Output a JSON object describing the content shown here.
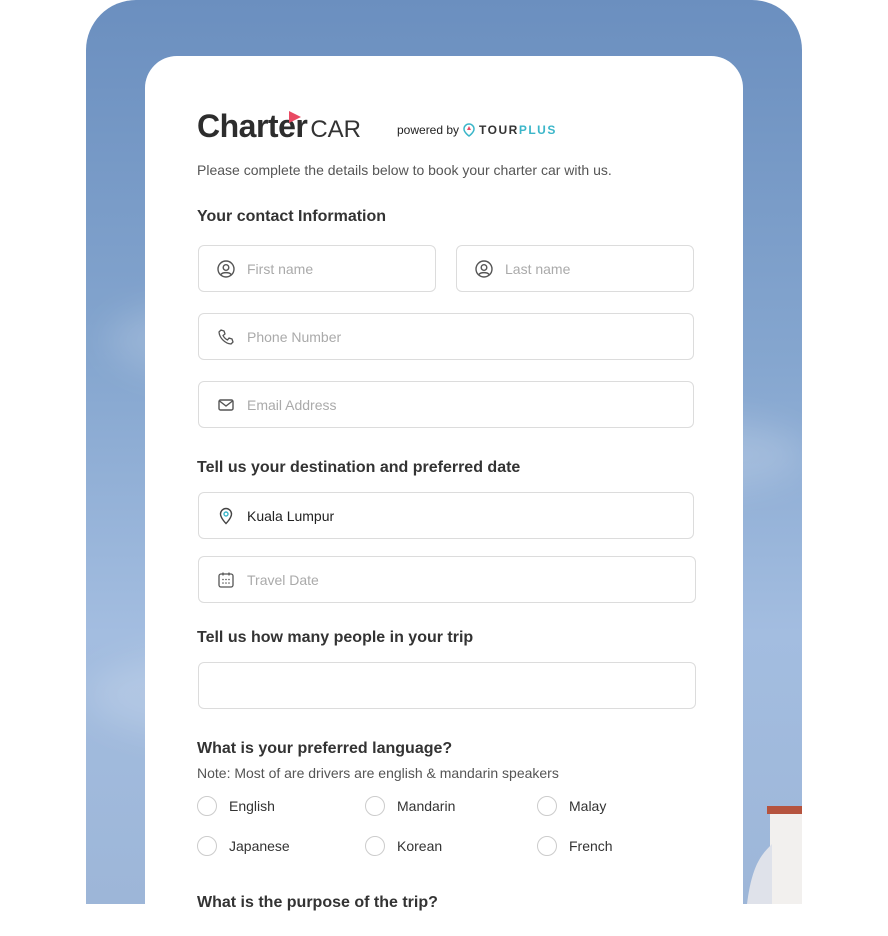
{
  "brand": {
    "name_bold": "Charter",
    "name_light": "CAR",
    "powered_by": "powered by",
    "partner_a": "TOUR",
    "partner_b": "PLUS",
    "accent": "#e94a63",
    "partner_color": "#3bb6c9"
  },
  "intro": "Please complete the details below to book your charter car with us.",
  "contact": {
    "heading": "Your contact Information",
    "first_name": "First name",
    "last_name": "Last name",
    "phone": "Phone Number",
    "email": "Email Address"
  },
  "destination": {
    "heading": "Tell us your destination and preferred date",
    "value": "Kuala Lumpur",
    "date_placeholder": "Travel Date"
  },
  "people": {
    "heading": "Tell us how many people in your trip",
    "value": ""
  },
  "language": {
    "heading": "What is your preferred language?",
    "note": "Note: Most of are drivers are english & mandarin speakers",
    "options": [
      "English",
      "Mandarin",
      "Malay",
      "Japanese",
      "Korean",
      "French"
    ]
  },
  "purpose": {
    "heading": "What is the purpose of the trip?"
  }
}
